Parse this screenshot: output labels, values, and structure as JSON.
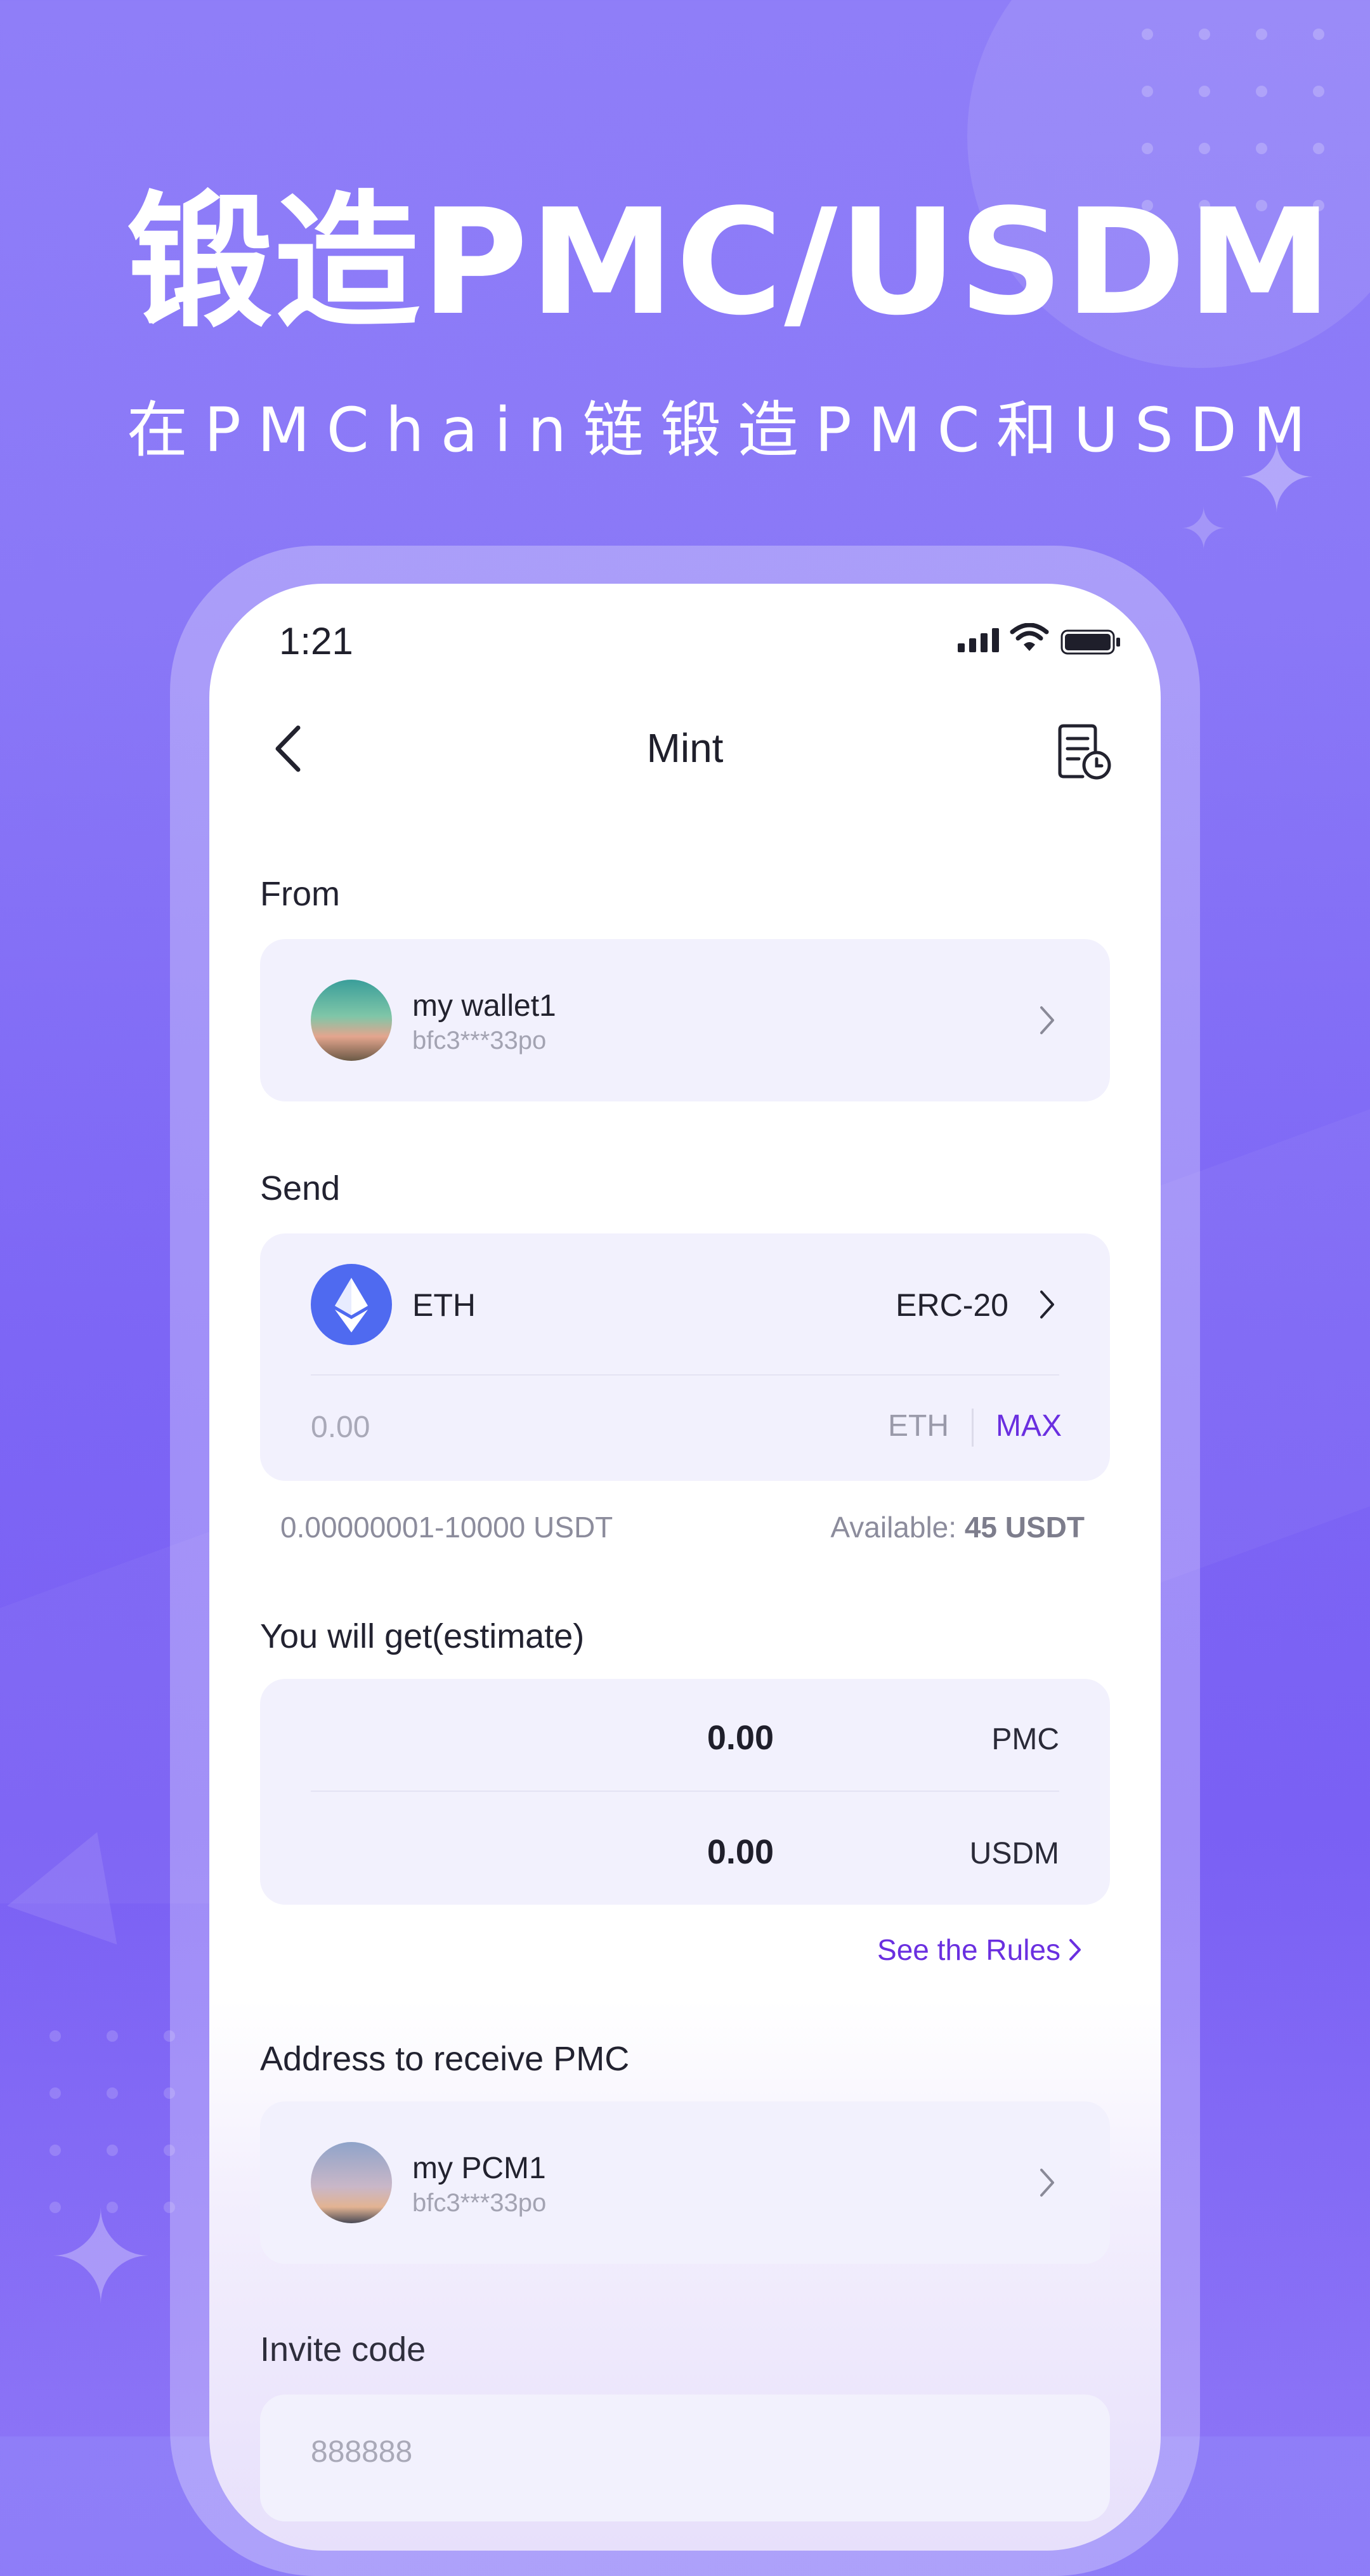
{
  "promo": {
    "headline": "锻造PMC/USDM",
    "subline": "在PMChain链锻造PMC和USDM"
  },
  "status_bar": {
    "time": "1:21"
  },
  "nav": {
    "title": "Mint",
    "back_icon": "chevron-left-icon",
    "history_icon": "document-clock-icon"
  },
  "from": {
    "label": "From",
    "wallet_name": "my wallet1",
    "wallet_address": "bfc3***33po"
  },
  "send": {
    "label": "Send",
    "token": "ETH",
    "network": "ERC-20",
    "amount_placeholder": "0.00",
    "unit": "ETH",
    "max_label": "MAX",
    "range": "0.00000001-10000 USDT",
    "available_label": "Available:",
    "available_value": "45 USDT"
  },
  "estimate": {
    "label": "You will get(estimate)",
    "rows": [
      {
        "value": "0.00",
        "unit": "PMC"
      },
      {
        "value": "0.00",
        "unit": "USDM"
      }
    ],
    "rules_link": "See the Rules"
  },
  "receive": {
    "label": "Address to receive PMC",
    "wallet_name": "my PCM1",
    "wallet_address": "bfc3***33po"
  },
  "invite": {
    "label": "Invite code",
    "placeholder": "888888"
  },
  "colors": {
    "background": "#8a78f7",
    "accent": "#6a2fe0",
    "card": "#f2f1fd",
    "eth_blue": "#4f6af0"
  }
}
